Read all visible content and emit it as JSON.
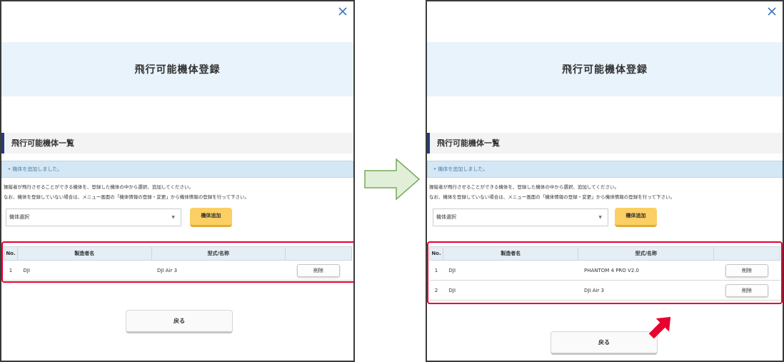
{
  "dialog": {
    "title": "飛行可能機体登録",
    "section_title": "飛行可能機体一覧",
    "notice": "• 機体を追加しました。",
    "description_line1": "操縦者が飛行させることができる機体を、登録した機体の中から選択、追加してください。",
    "description_line2": "なお、機体を登録していない場合は、メニュー画面の「機体情報の登録・変更」から機体情報の登録を行って下さい。",
    "select_value": "機体選択",
    "select_caret": "▼",
    "add_button": "機体追加",
    "back_button": "戻る"
  },
  "table": {
    "headers": [
      "No.",
      "製造者名",
      "型式/名称",
      ""
    ],
    "delete_label": "削除"
  },
  "before": {
    "rows": [
      {
        "no": "1",
        "maker": "DJI",
        "model": "DJI Air 3"
      }
    ]
  },
  "after": {
    "rows": [
      {
        "no": "1",
        "maker": "DJI",
        "model": "PHANTOM 4 PRO V2.0"
      },
      {
        "no": "2",
        "maker": "DJI",
        "model": "DJI Air 3"
      }
    ]
  },
  "colors": {
    "title_band": "#e8f3fb",
    "notice_bg": "#d4e7f4",
    "accent_bar": "#1e3f7a",
    "add_button": "#fbcf63",
    "highlight_frame": "#e8002f",
    "transition_arrow_fill": "#e2efd8",
    "transition_arrow_stroke": "#77a85a",
    "pointer_arrow": "#e8002f"
  }
}
